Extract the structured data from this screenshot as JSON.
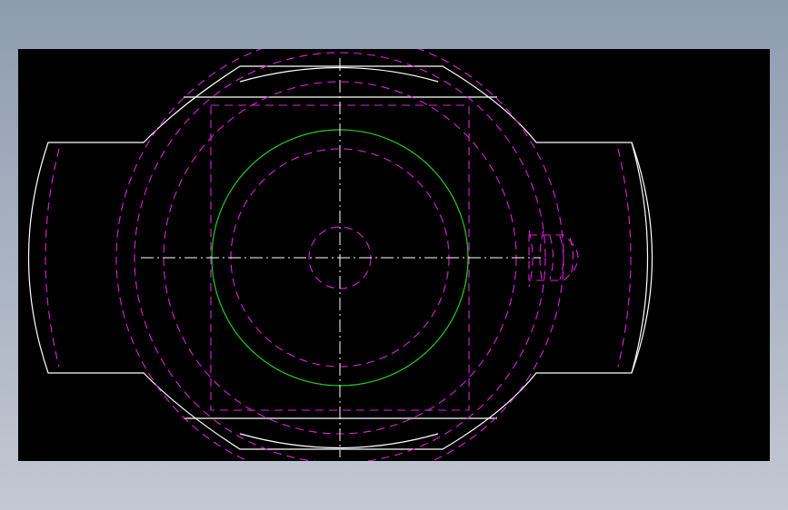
{
  "drawing": {
    "background": "#000000",
    "colors": {
      "outline": "#ffffff",
      "hidden": "#e020e0",
      "highlight": "#22cc22",
      "centerline": "#ffffff"
    },
    "line_types": [
      "continuous",
      "dashed",
      "dash-dot"
    ],
    "labels": []
  }
}
